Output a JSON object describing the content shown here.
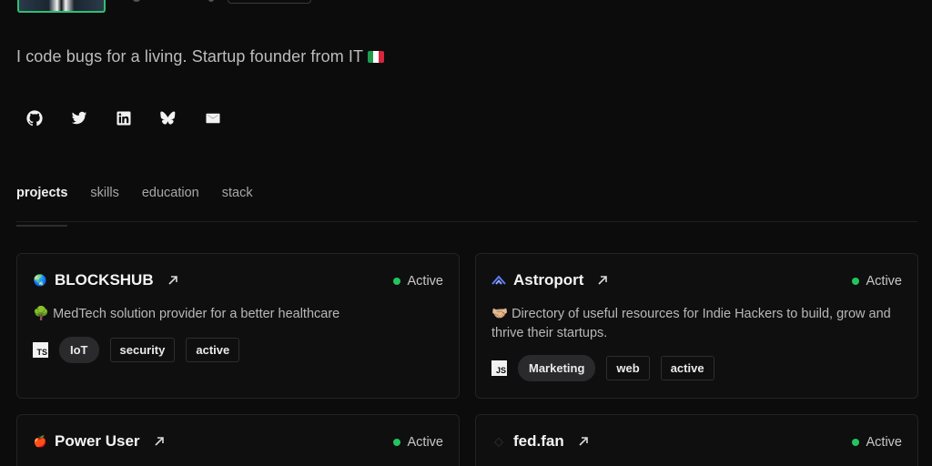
{
  "profile": {
    "bio": "I code bugs for a living. Startup founder from IT"
  },
  "socials": [
    {
      "name": "github-icon"
    },
    {
      "name": "twitter-icon"
    },
    {
      "name": "linkedin-icon"
    },
    {
      "name": "bluesky-icon"
    },
    {
      "name": "mail-icon"
    }
  ],
  "tabs": [
    {
      "label": "projects",
      "active": true
    },
    {
      "label": "skills",
      "active": false
    },
    {
      "label": "education",
      "active": false
    },
    {
      "label": "stack",
      "active": false
    }
  ],
  "projects": [
    {
      "title": "BLOCKSHUB",
      "icon": "🌏",
      "status": "Active",
      "description": "🌳 MedTech solution provider for a better healthcare",
      "lang": "TS",
      "tags": [
        "IoT",
        "security",
        "active"
      ]
    },
    {
      "title": "Astroport",
      "icon": "astroport-icon",
      "status": "Active",
      "description": "🤝🏼 Directory of useful resources for Indie Hackers to build, grow and thrive their startups.",
      "lang": "JS",
      "tags": [
        "Marketing",
        "web",
        "active"
      ]
    },
    {
      "title": "Power User",
      "icon": "🍎",
      "status": "Active"
    },
    {
      "title": "fed.fan",
      "icon": "◆",
      "status": "Active"
    }
  ],
  "colors": {
    "background": "#0c0c0d",
    "status_active": "#22c55e",
    "avatar_border": "#2fbf71"
  }
}
